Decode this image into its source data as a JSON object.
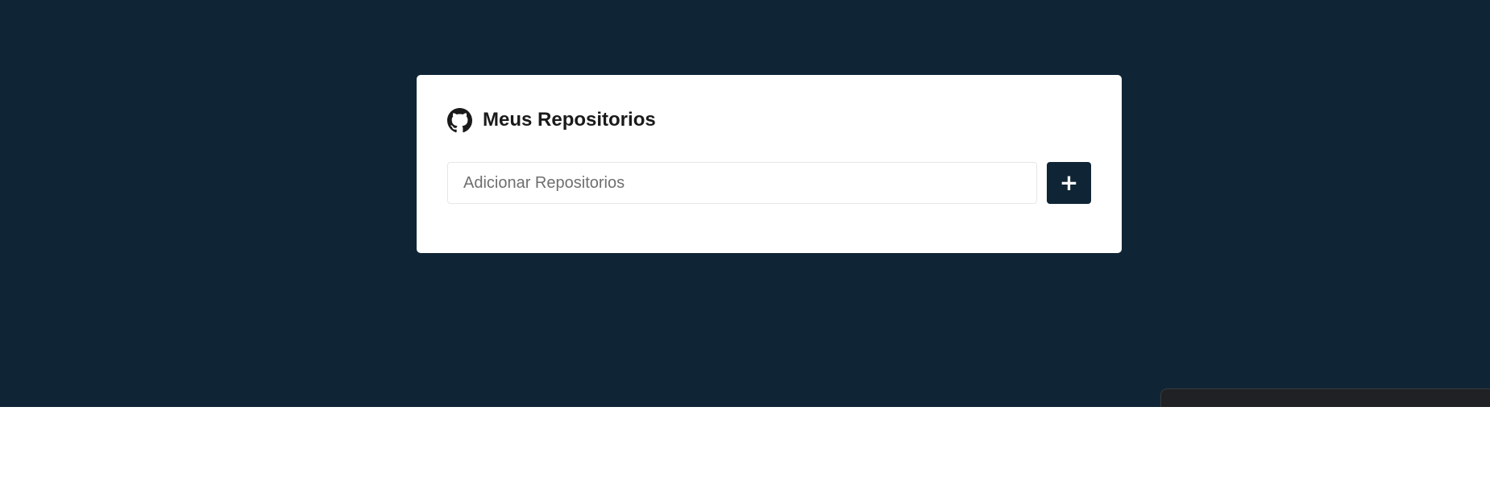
{
  "card": {
    "title": "Meus Repositorios",
    "icon": "github-icon"
  },
  "form": {
    "input_placeholder": "Adicionar Repositorios",
    "input_value": "",
    "add_button_label": "+"
  },
  "colors": {
    "page_background": "#0f2536",
    "card_background": "#ffffff",
    "button_background": "#0f2536",
    "button_text": "#ffffff",
    "title_text": "#1a1a1a"
  }
}
